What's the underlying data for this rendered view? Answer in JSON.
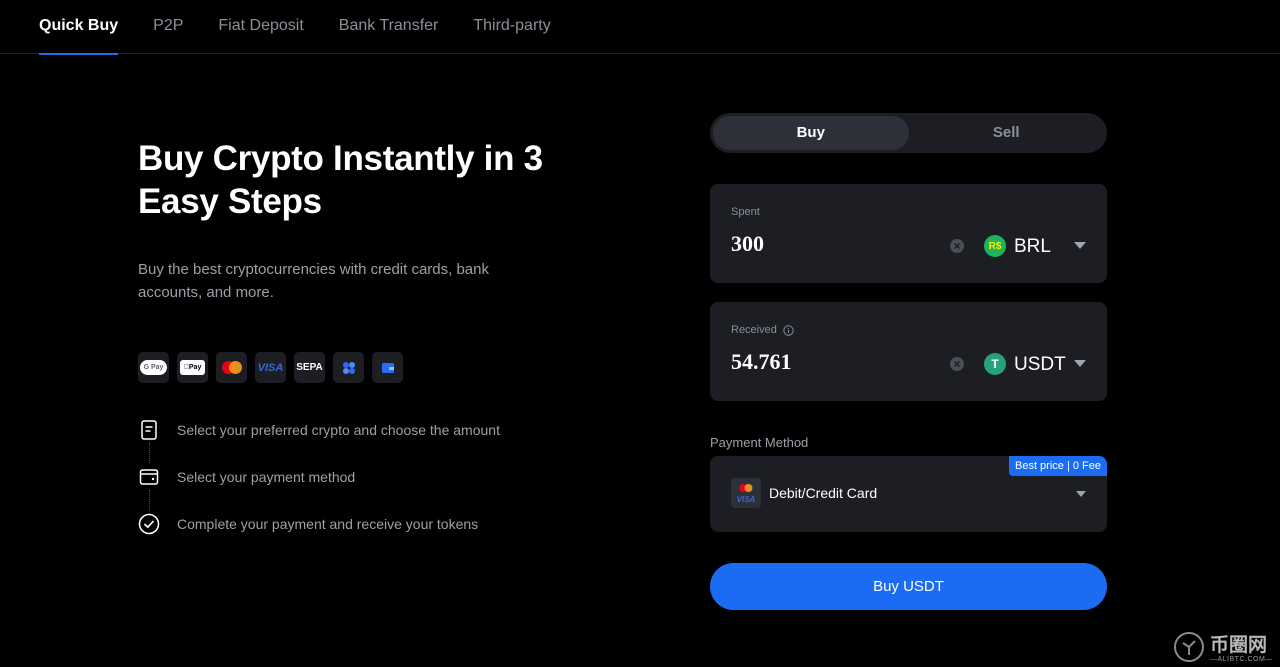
{
  "nav": {
    "tabs": [
      {
        "label": "Quick Buy",
        "active": true
      },
      {
        "label": "P2P"
      },
      {
        "label": "Fiat Deposit"
      },
      {
        "label": "Bank Transfer"
      },
      {
        "label": "Third-party"
      }
    ]
  },
  "hero": {
    "title": "Buy Crypto Instantly in 3 Easy Steps",
    "subtitle": "Buy the best cryptocurrencies with credit cards, bank accounts, and more."
  },
  "payment_icons": [
    "G Pay",
    "Pay",
    "mastercard",
    "VISA",
    "SEPA",
    "wallet-app",
    "wallet"
  ],
  "steps": [
    {
      "icon": "document-icon",
      "text": "Select your preferred crypto and choose the amount"
    },
    {
      "icon": "wallet-icon",
      "text": "Select your payment method"
    },
    {
      "icon": "check-circle-icon",
      "text": "Complete your payment and receive your tokens"
    }
  ],
  "trade": {
    "buy_label": "Buy",
    "sell_label": "Sell",
    "spent": {
      "label": "Spent",
      "value": "300",
      "currency": "BRL",
      "coin_symbol": "R$"
    },
    "received": {
      "label": "Received",
      "value": "54.761",
      "currency": "USDT",
      "coin_symbol": "T"
    },
    "payment_method": {
      "label": "Payment Method",
      "badge": "Best price | 0 Fee",
      "value": "Debit/Credit Card"
    },
    "submit_label": "Buy USDT"
  },
  "watermark": {
    "text": "币圈网",
    "sub": "—ALIBTC.COM—"
  },
  "colors": {
    "accent": "#1b6cf2",
    "panel": "#1c1e23",
    "brl_green": "#1db45a",
    "usdt_teal": "#26a17b"
  }
}
